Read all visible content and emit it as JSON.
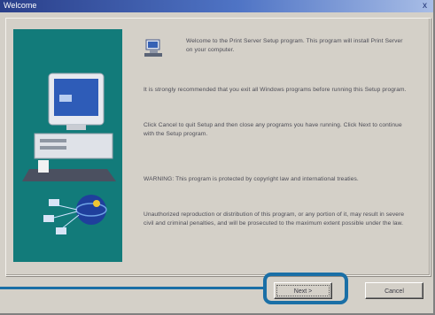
{
  "window": {
    "title": "Welcome",
    "close_glyph": "x"
  },
  "content": {
    "paragraphs": [
      "Welcome to the Print Server Setup program. This program will install Print Server on your computer.",
      "It is strongly recommended that you exit all Windows programs before running this Setup program.",
      "Click Cancel to quit Setup and then close any programs you have running. Click Next to continue with the Setup program.",
      "WARNING: This program is protected by copyright law and international treaties.",
      "Unauthorized reproduction or distribution of this program, or any portion of it, may result in severe civil and criminal penalties, and will be prosecuted to the maximum extent possible under the law."
    ]
  },
  "buttons": {
    "next": "Next >",
    "cancel": "Cancel"
  },
  "icons": {
    "header_icon": "computer-setup-icon",
    "art": "computer-and-network-illustration"
  },
  "colors": {
    "art_background": "#127b7a",
    "highlight": "#1a6fa6"
  }
}
